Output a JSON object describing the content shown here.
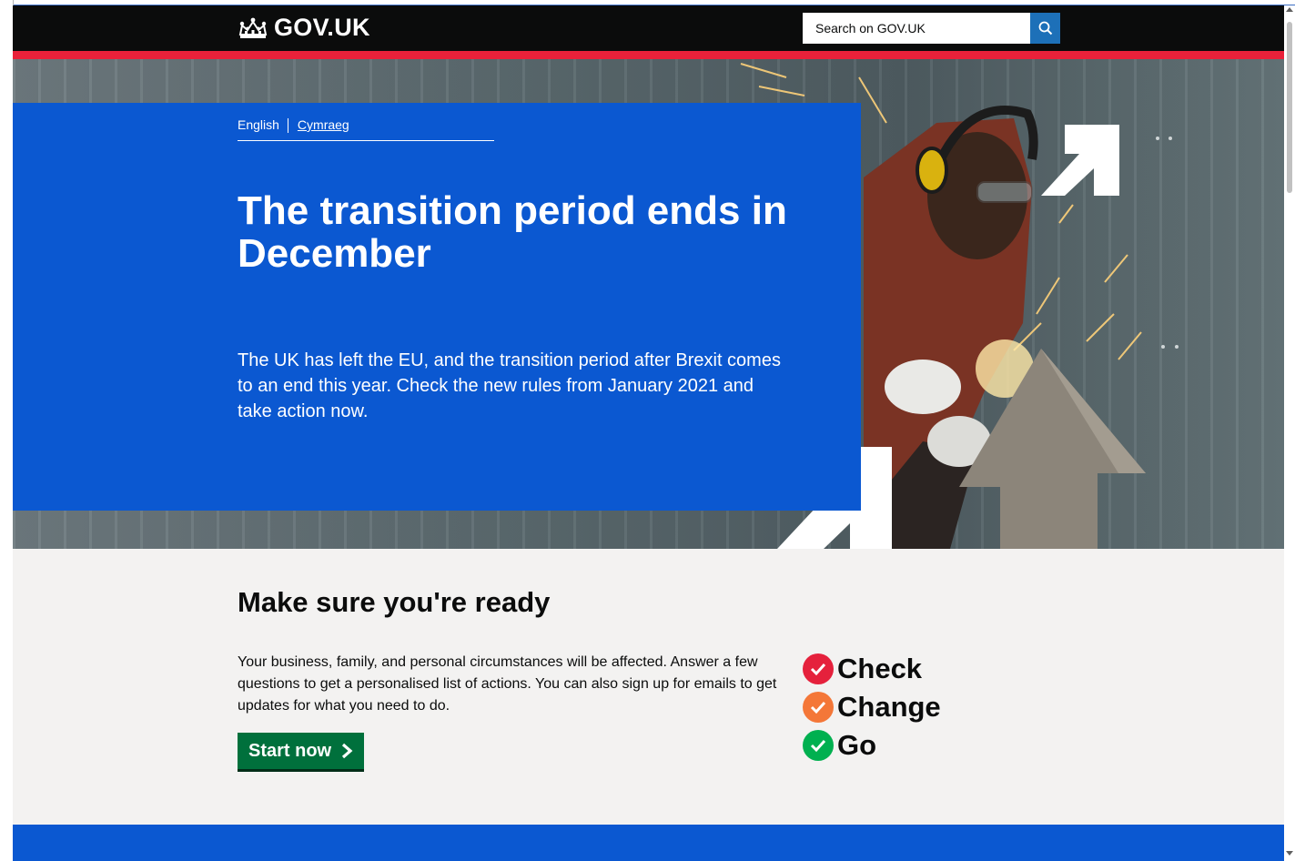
{
  "header": {
    "logo_text": "GOV.UK",
    "logo_icon": "crown-icon",
    "search_placeholder": "Search on GOV.UK",
    "search_icon": "search-icon"
  },
  "hero": {
    "languages": {
      "current": "English",
      "other": "Cymraeg"
    },
    "title": "The transition period ends in December",
    "text": "The UK has left the EU, and the transition period after Brexit comes to an end this year. Check the new rules from January 2021 and take action now."
  },
  "ready": {
    "title": "Make sure you're ready",
    "text": "Your business, family, and personal circumstances will be affected. Answer a few questions to get a personalised list of actions. You can also sign up for emails to get updates for what you need to do.",
    "button_label": "Start now",
    "campaign": [
      {
        "word": "Check",
        "color": "#e5213c",
        "icon": "check-icon"
      },
      {
        "word": "Change",
        "color": "#f47738",
        "icon": "check-icon"
      },
      {
        "word": "Go",
        "color": "#00b050",
        "icon": "check-icon"
      }
    ]
  },
  "colors": {
    "header_bg": "#0b0c0c",
    "header_stripe": "#e9213a",
    "hero_panel": "#0b58d1",
    "start_button": "#00703c",
    "page_bg": "#f3f2f1"
  }
}
